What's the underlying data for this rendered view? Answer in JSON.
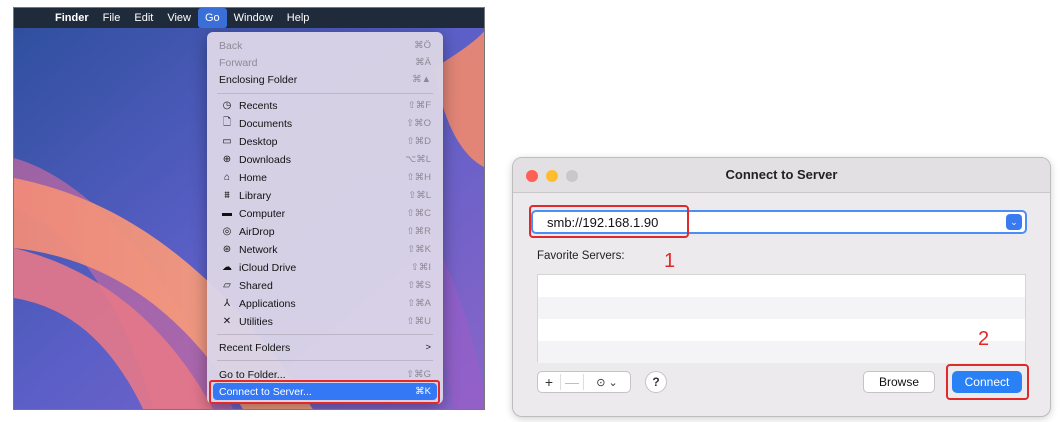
{
  "menubar": {
    "items": [
      "Finder",
      "File",
      "Edit",
      "View",
      "Go",
      "Window",
      "Help"
    ],
    "active": "Go"
  },
  "go_menu": {
    "top_items": [
      {
        "label": "Back",
        "shortcut": "⌘Ö",
        "disabled": true
      },
      {
        "label": "Forward",
        "shortcut": "⌘Ä",
        "disabled": true
      },
      {
        "label": "Enclosing Folder",
        "shortcut": "⌘▲",
        "disabled": false
      }
    ],
    "places": [
      {
        "label": "Recents",
        "shortcut": "⇧⌘F",
        "icon": "clock-icon"
      },
      {
        "label": "Documents",
        "shortcut": "⇧⌘O",
        "icon": "document-icon"
      },
      {
        "label": "Desktop",
        "shortcut": "⇧⌘D",
        "icon": "desktop-icon"
      },
      {
        "label": "Downloads",
        "shortcut": "⌥⌘L",
        "icon": "download-icon"
      },
      {
        "label": "Home",
        "shortcut": "⇧⌘H",
        "icon": "home-icon"
      },
      {
        "label": "Library",
        "shortcut": "⇧⌘L",
        "icon": "library-icon"
      },
      {
        "label": "Computer",
        "shortcut": "⇧⌘C",
        "icon": "computer-icon"
      },
      {
        "label": "AirDrop",
        "shortcut": "⇧⌘R",
        "icon": "airdrop-icon"
      },
      {
        "label": "Network",
        "shortcut": "⇧⌘K",
        "icon": "network-icon"
      },
      {
        "label": "iCloud Drive",
        "shortcut": "⇧⌘I",
        "icon": "cloud-icon"
      },
      {
        "label": "Shared",
        "shortcut": "⇧⌘S",
        "icon": "shared-folder-icon"
      },
      {
        "label": "Applications",
        "shortcut": "⇧⌘A",
        "icon": "applications-icon"
      },
      {
        "label": "Utilities",
        "shortcut": "⇧⌘U",
        "icon": "utilities-icon"
      }
    ],
    "recent_folders": {
      "label": "Recent Folders",
      "shortcut": ">"
    },
    "go_to_folder": {
      "label": "Go to Folder...",
      "shortcut": "⇧⌘G"
    },
    "connect_to_server": {
      "label": "Connect to Server...",
      "shortcut": "⌘K"
    }
  },
  "dialog": {
    "title": "Connect to Server",
    "address_value": "smb://192.168.1.90",
    "favorites_label": "Favorite Servers:",
    "browse_label": "Browse",
    "connect_label": "Connect",
    "add_symbol": "+",
    "remove_symbol": "—",
    "options_symbol": "⊙ ⌄",
    "help_symbol": "?"
  },
  "annotations": {
    "step1": "1",
    "step2": "2"
  },
  "colors": {
    "highlight": "#3478f6",
    "annotation_red": "#e02a2a",
    "connect_button": "#2a80f5"
  }
}
